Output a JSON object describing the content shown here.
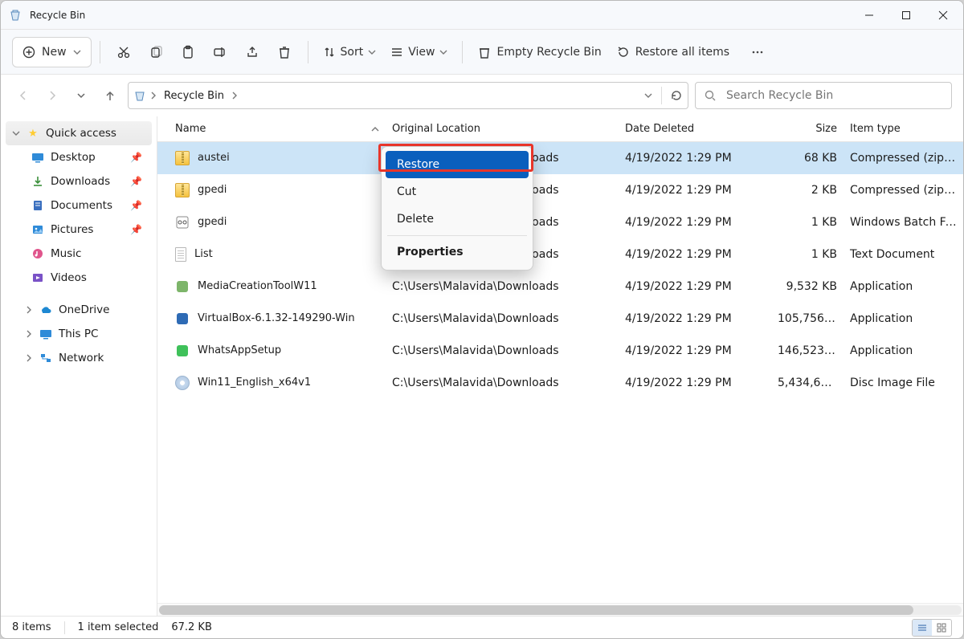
{
  "window": {
    "title": "Recycle Bin"
  },
  "toolbar": {
    "new_label": "New",
    "sort_label": "Sort",
    "view_label": "View",
    "empty_label": "Empty Recycle Bin",
    "restore_all_label": "Restore all items"
  },
  "breadcrumb": {
    "segments": [
      "Recycle Bin"
    ]
  },
  "search": {
    "placeholder": "Search Recycle Bin"
  },
  "sidebar": {
    "quick_access": "Quick access",
    "items": [
      {
        "label": "Desktop",
        "pinned": true,
        "color": "#2f8bd8"
      },
      {
        "label": "Downloads",
        "pinned": true,
        "color": "#3b8f3b"
      },
      {
        "label": "Documents",
        "pinned": true,
        "color": "#3a6fbf"
      },
      {
        "label": "Pictures",
        "pinned": true,
        "color": "#2f8bd8"
      },
      {
        "label": "Music",
        "pinned": false,
        "color": "#e0558c"
      },
      {
        "label": "Videos",
        "pinned": false,
        "color": "#7a52c7"
      }
    ],
    "roots": [
      {
        "label": "OneDrive"
      },
      {
        "label": "This PC"
      },
      {
        "label": "Network"
      }
    ]
  },
  "columns": {
    "name": "Name",
    "orig": "Original Location",
    "date": "Date Deleted",
    "size": "Size",
    "type": "Item type"
  },
  "files": [
    {
      "name": "austei",
      "icon": "zip",
      "orig": "C:\\Users\\Malavida\\Downloads",
      "date": "4/19/2022 1:29 PM",
      "size": "68 KB",
      "type": "Compressed (zipp…",
      "selected": true
    },
    {
      "name": "gpedi",
      "icon": "zip",
      "orig": "C:\\Users\\Malavida\\Downloads",
      "date": "4/19/2022 1:29 PM",
      "size": "2 KB",
      "type": "Compressed (zipp…"
    },
    {
      "name": "gpedi",
      "icon": "bat",
      "orig": "C:\\Users\\Malavida\\Downloads",
      "date": "4/19/2022 1:29 PM",
      "size": "1 KB",
      "type": "Windows Batch File"
    },
    {
      "name": "List",
      "icon": "txt",
      "orig": "C:\\Users\\Malavida\\Downloads",
      "date": "4/19/2022 1:29 PM",
      "size": "1 KB",
      "type": "Text Document"
    },
    {
      "name": "MediaCreationToolW11",
      "icon": "exe",
      "orig": "C:\\Users\\Malavida\\Downloads",
      "date": "4/19/2022 1:29 PM",
      "size": "9,532 KB",
      "type": "Application"
    },
    {
      "name": "VirtualBox-6.1.32-149290-Win",
      "icon": "exe",
      "orig": "C:\\Users\\Malavida\\Downloads",
      "date": "4/19/2022 1:29 PM",
      "size": "105,756 KB",
      "type": "Application"
    },
    {
      "name": "WhatsAppSetup",
      "icon": "exe",
      "orig": "C:\\Users\\Malavida\\Downloads",
      "date": "4/19/2022 1:29 PM",
      "size": "146,523 KB",
      "type": "Application"
    },
    {
      "name": "Win11_English_x64v1",
      "icon": "iso",
      "orig": "C:\\Users\\Malavida\\Downloads",
      "date": "4/19/2022 1:29 PM",
      "size": "5,434,622 …",
      "type": "Disc Image File"
    }
  ],
  "context_menu": {
    "items": [
      {
        "label": "Restore",
        "selected": true
      },
      {
        "label": "Cut"
      },
      {
        "label": "Delete"
      },
      {
        "label": "Properties",
        "bold": true
      }
    ]
  },
  "status": {
    "count": "8 items",
    "selection": "1 item selected",
    "sel_size": "67.2 KB"
  }
}
